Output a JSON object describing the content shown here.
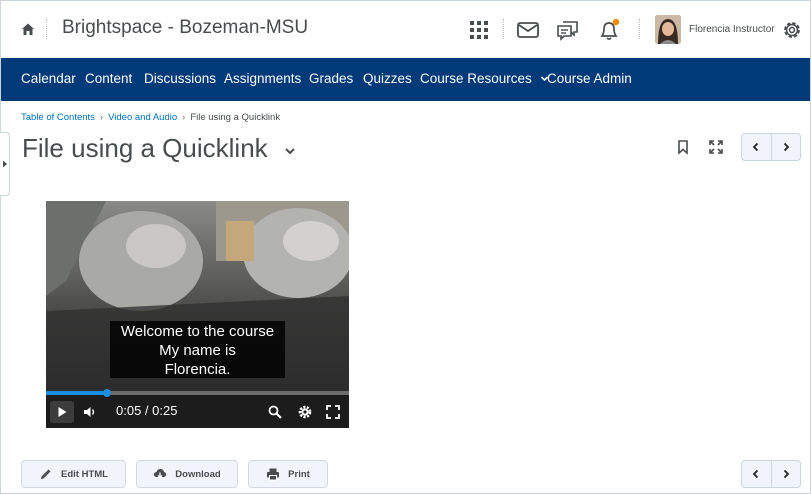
{
  "header": {
    "org_title": "Brightspace - Bozeman-MSU",
    "user_name": "Florencia Instructor",
    "icons": [
      "home-icon",
      "grid-icon",
      "mail-icon",
      "chat-icon",
      "bell-icon",
      "gear-icon"
    ],
    "notification_color": "#f18a00"
  },
  "nav": {
    "bg_color": "#003a79",
    "items": [
      "Calendar",
      "Content",
      "Discussions",
      "Assignments",
      "Grades",
      "Quizzes",
      "Course Resources",
      "Course Admin"
    ]
  },
  "breadcrumb": {
    "items": [
      "Table of Contents",
      "Video and Audio"
    ],
    "current": "File using a Quicklink",
    "separator": "›"
  },
  "page": {
    "title": "File using a Quicklink"
  },
  "video": {
    "caption_lines": [
      "Welcome to the course",
      "My name is",
      "Florencia."
    ],
    "time": "0:05 / 0:25",
    "progress": 0.2,
    "accent_color": "#1a8fe0"
  },
  "actions": {
    "edit_html": "Edit HTML",
    "download": "Download",
    "print": "Print"
  }
}
